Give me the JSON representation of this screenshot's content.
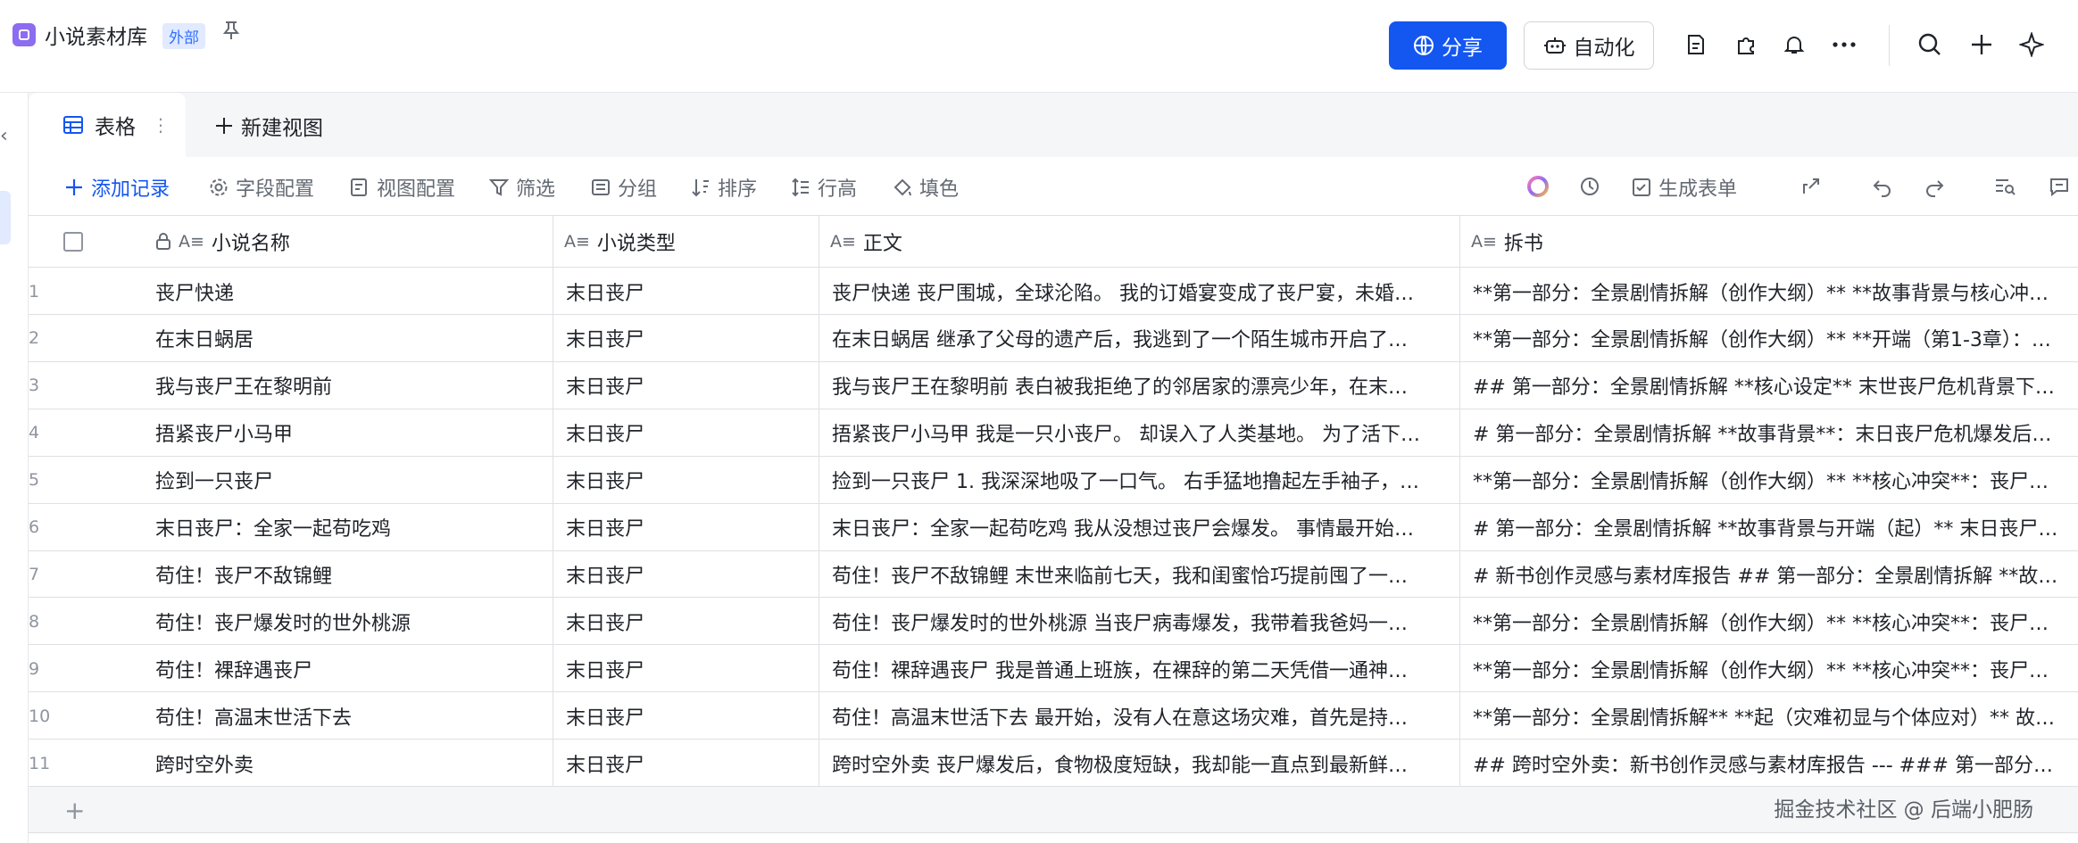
{
  "app": {
    "title": "小说素材库",
    "badge": "外部",
    "share_label": "分享",
    "automation_label": "自动化"
  },
  "views": {
    "active_tab": "表格",
    "new_view_label": "新建视图"
  },
  "toolbar": {
    "add_record": "添加记录",
    "field_config": "字段配置",
    "view_config": "视图配置",
    "filter": "筛选",
    "group": "分组",
    "sort": "排序",
    "row_height": "行高",
    "fill_color": "填色",
    "generate_form": "生成表单"
  },
  "table": {
    "columns": [
      "小说名称",
      "小说类型",
      "正文",
      "拆书"
    ],
    "rows": [
      {
        "no": "1",
        "name": "丧尸快递",
        "type": "末日丧尸",
        "body": "丧尸快递 丧尸围城，全球沦陷。 我的订婚宴变成了丧尸宴，未婚…",
        "breakdown": "**第一部分：全景剧情拆解（创作大纲）** **故事背景与核心冲…"
      },
      {
        "no": "2",
        "name": "在末日蜗居",
        "type": "末日丧尸",
        "body": "在末日蜗居 继承了父母的遗产后，我逃到了一个陌生城市开启了…",
        "breakdown": "**第一部分：全景剧情拆解（创作大纲）** **开端（第1-3章）：…"
      },
      {
        "no": "3",
        "name": "我与丧尸王在黎明前",
        "type": "末日丧尸",
        "body": "我与丧尸王在黎明前 表白被我拒绝了的邻居家的漂亮少年，在末…",
        "breakdown": "## 第一部分：全景剧情拆解 **核心设定** 末世丧尸危机背景下…"
      },
      {
        "no": "4",
        "name": "捂紧丧尸小马甲",
        "type": "末日丧尸",
        "body": "捂紧丧尸小马甲 我是一只小丧尸。 却误入了人类基地。 为了活下…",
        "breakdown": "# 第一部分：全景剧情拆解 **故事背景**：末日丧尸危机爆发后…"
      },
      {
        "no": "5",
        "name": "捡到一只丧尸",
        "type": "末日丧尸",
        "body": "捡到一只丧尸 1. 我深深地吸了一口气。 右手猛地撸起左手袖子，…",
        "breakdown": "**第一部分：全景剧情拆解（创作大纲）** **核心冲突**：丧尸…"
      },
      {
        "no": "6",
        "name": "末日丧尸：全家一起苟吃鸡",
        "type": "末日丧尸",
        "body": "末日丧尸：全家一起苟吃鸡 我从没想过丧尸会爆发。 事情最开始…",
        "breakdown": "# 第一部分：全景剧情拆解 **故事背景与开端（起）** 末日丧尸…"
      },
      {
        "no": "7",
        "name": "苟住！丧尸不敌锦鲤",
        "type": "末日丧尸",
        "body": "苟住！丧尸不敌锦鲤 末世来临前七天，我和闺蜜恰巧提前囤了一…",
        "breakdown": "# 新书创作灵感与素材库报告 ## 第一部分：全景剧情拆解 **故…"
      },
      {
        "no": "8",
        "name": "苟住！丧尸爆发时的世外桃源",
        "type": "末日丧尸",
        "body": "苟住！丧尸爆发时的世外桃源 当丧尸病毒爆发，我带着我爸妈一…",
        "breakdown": "**第一部分：全景剧情拆解（创作大纲）** **核心冲突**：丧尸…"
      },
      {
        "no": "9",
        "name": "苟住！裸辞遇丧尸",
        "type": "末日丧尸",
        "body": "苟住！裸辞遇丧尸 我是普通上班族，在裸辞的第二天凭借一通神…",
        "breakdown": "**第一部分：全景剧情拆解（创作大纲）** **核心冲突**：丧尸…"
      },
      {
        "no": "10",
        "name": "苟住！高温末世活下去",
        "type": "末日丧尸",
        "body": "苟住！高温末世活下去 最开始，没有人在意这场灾难，首先是持…",
        "breakdown": "**第一部分：全景剧情拆解** **起（灾难初显与个体应对）** 故…"
      },
      {
        "no": "11",
        "name": "跨时空外卖",
        "type": "末日丧尸",
        "body": "跨时空外卖 丧尸爆发后，食物极度短缺，我却能一直点到最新鲜…",
        "breakdown": "## 跨时空外卖：新书创作灵感与素材库报告 --- ### 第一部分：…"
      }
    ]
  },
  "watermark": "掘金技术社区 @ 后端小肥肠"
}
